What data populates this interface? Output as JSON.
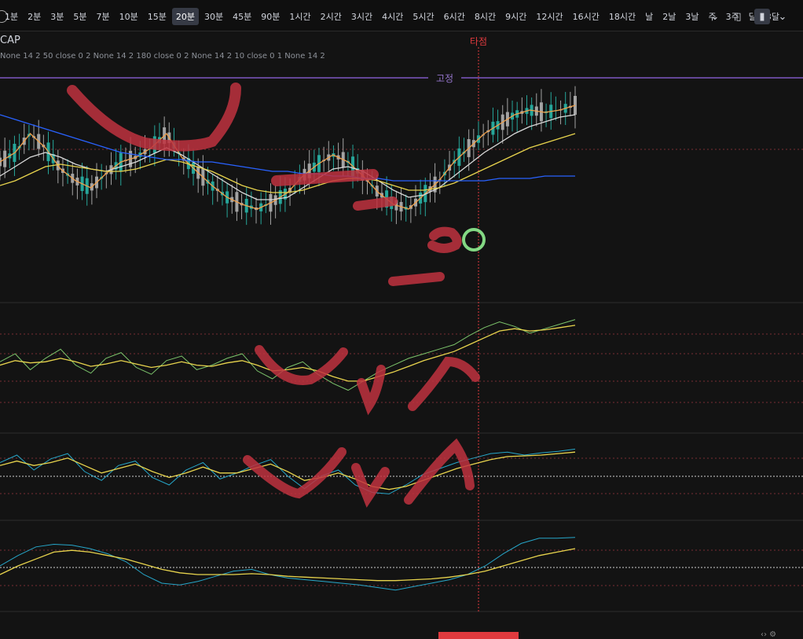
{
  "toolbar": {
    "timeframes": [
      "1분",
      "2분",
      "3분",
      "5분",
      "7분",
      "10분",
      "15분",
      "20분",
      "30분",
      "45분",
      "90분",
      "1시간",
      "2시간",
      "3시간",
      "4시간",
      "5시간",
      "6시간",
      "8시간",
      "9시간",
      "12시간",
      "16시간",
      "18시간",
      "날",
      "2날",
      "3날",
      "주",
      "3주",
      "달",
      "3달"
    ],
    "active_timeframe": "20분",
    "more_icon": "chevron-down-icon",
    "chart_type_icons": [
      "candle-outline-icon",
      "candle-filled-icon"
    ]
  },
  "symbol": "CAP",
  "indicator_params": "None 14 2 50 close 0 2 None 14 2 180 close 0 2 None 14 2 10 close 0 1 None 14 2",
  "annotations": {
    "vertical_line_label": "타점",
    "horizontal_line_label": "고정"
  },
  "colors": {
    "background": "#131313",
    "blue_ma": "#2962ff",
    "yellow_ma": "#e8d44d",
    "white_ma": "#d9d9d9",
    "orange_ma": "#f0a04b",
    "candle_up": "#26a69a",
    "candle_down": "#a3a3a3",
    "markup": "#c0323f",
    "fixed_line": "#7e57c2",
    "vertical_line": "#e03a3e",
    "circle": "#90ee90"
  },
  "chart_data": [
    {
      "type": "line",
      "panel": "price",
      "series": [
        {
          "values": [
            58,
            62,
            70,
            64,
            55,
            50,
            47,
            53,
            58,
            60,
            64,
            70,
            60,
            54,
            48,
            43,
            40,
            38,
            41,
            45,
            52,
            57,
            61,
            58,
            52,
            45,
            40,
            38,
            44,
            50,
            58,
            64,
            70,
            74,
            78,
            80,
            79,
            80,
            82
          ]
        },
        {
          "values": [
            52,
            56,
            60,
            62,
            60,
            57,
            55,
            54,
            56,
            58,
            61,
            64,
            61,
            57,
            53,
            49,
            45,
            42,
            42,
            43,
            47,
            51,
            55,
            56,
            54,
            50,
            46,
            43,
            44,
            47,
            52,
            57,
            62,
            66,
            70,
            73,
            75,
            77,
            78
          ]
        },
        {
          "values": [
            48,
            50,
            53,
            56,
            57,
            56,
            55,
            54,
            54,
            55,
            57,
            59,
            58,
            56,
            54,
            51,
            48,
            46,
            45,
            45,
            46,
            48,
            50,
            51,
            51,
            50,
            48,
            46,
            46,
            47,
            49,
            52,
            55,
            58,
            61,
            64,
            66,
            68,
            70
          ]
        },
        {
          "values": [
            78,
            76,
            74,
            72,
            70,
            68,
            66,
            64,
            62,
            61,
            60,
            59,
            59,
            58,
            58,
            57,
            56,
            55,
            54,
            54,
            53,
            53,
            52,
            52,
            51,
            51,
            50,
            50,
            50,
            50,
            50,
            50,
            50,
            51,
            51,
            51,
            52,
            52,
            52
          ]
        }
      ]
    },
    {
      "type": "line",
      "panel": "oscillator-1",
      "series": [
        {
          "values": [
            55,
            62,
            48,
            58,
            66,
            52,
            45,
            58,
            63,
            50,
            44,
            56,
            60,
            48,
            52,
            58,
            62,
            47,
            40,
            50,
            55,
            44,
            36,
            30,
            38,
            46,
            52,
            58,
            62,
            66,
            70,
            78,
            85,
            90,
            86,
            80,
            84,
            88,
            92
          ]
        },
        {
          "values": [
            52,
            56,
            54,
            55,
            58,
            55,
            51,
            53,
            56,
            53,
            50,
            52,
            55,
            52,
            51,
            54,
            56,
            52,
            47,
            48,
            50,
            47,
            42,
            38,
            38,
            42,
            46,
            51,
            56,
            60,
            64,
            70,
            76,
            82,
            84,
            82,
            83,
            85,
            87
          ]
        }
      ]
    },
    {
      "type": "line",
      "panel": "oscillator-2",
      "series": [
        {
          "values": [
            70,
            80,
            60,
            75,
            82,
            58,
            46,
            66,
            72,
            50,
            40,
            60,
            70,
            48,
            56,
            66,
            74,
            52,
            35,
            52,
            60,
            40,
            30,
            28,
            40,
            54,
            62,
            70,
            76,
            82,
            84,
            80,
            83,
            85,
            88
          ]
        },
        {
          "values": [
            66,
            72,
            66,
            70,
            76,
            66,
            56,
            62,
            68,
            58,
            50,
            56,
            64,
            56,
            56,
            62,
            68,
            58,
            46,
            50,
            56,
            48,
            38,
            34,
            38,
            46,
            54,
            62,
            68,
            74,
            78,
            79,
            80,
            82,
            84
          ]
        }
      ]
    },
    {
      "type": "line",
      "panel": "oscillator-3",
      "series": [
        {
          "values": [
            50,
            62,
            72,
            75,
            74,
            70,
            64,
            55,
            40,
            30,
            28,
            32,
            38,
            44,
            46,
            40,
            36,
            34,
            32,
            30,
            28,
            25,
            22,
            26,
            30,
            34,
            40,
            50,
            64,
            76,
            82,
            82,
            83
          ]
        },
        {
          "values": [
            40,
            50,
            58,
            66,
            68,
            66,
            62,
            58,
            52,
            46,
            42,
            40,
            40,
            40,
            41,
            40,
            38,
            37,
            36,
            35,
            34,
            33,
            33,
            34,
            35,
            37,
            40,
            44,
            50,
            56,
            62,
            66,
            70
          ]
        }
      ]
    }
  ]
}
